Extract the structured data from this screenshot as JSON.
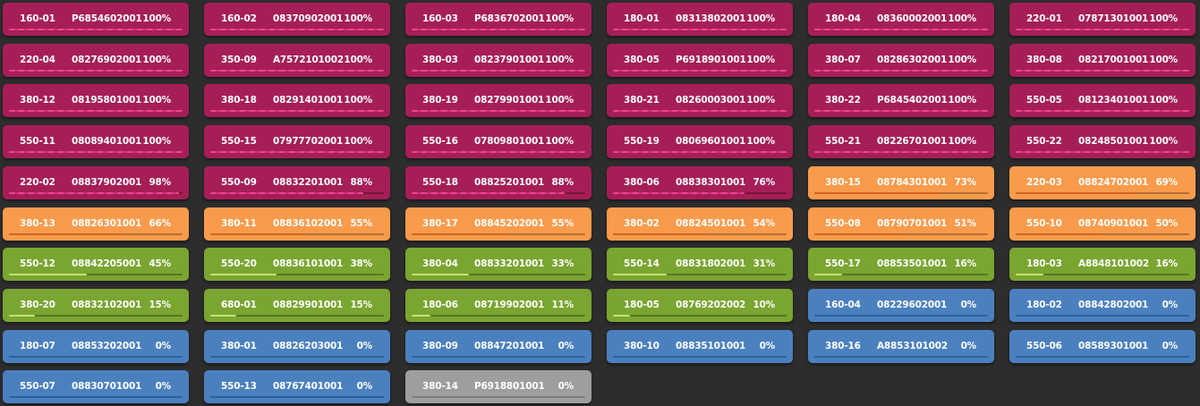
{
  "colors": {
    "complete": "#a61e57",
    "in_progress": "#f99b4b",
    "started": "#7aa531",
    "not_started": "#4b80bf",
    "inactive": "#9e9e9e"
  },
  "cards": [
    {
      "code": "160-01",
      "part": "P6854602001",
      "pct": "100%",
      "progress": 100,
      "status": "complete"
    },
    {
      "code": "160-02",
      "part": "08370902001",
      "pct": "100%",
      "progress": 100,
      "status": "complete"
    },
    {
      "code": "160-03",
      "part": "P6836702001",
      "pct": "100%",
      "progress": 100,
      "status": "complete"
    },
    {
      "code": "180-01",
      "part": "08313802001",
      "pct": "100%",
      "progress": 100,
      "status": "complete"
    },
    {
      "code": "180-04",
      "part": "08360002001",
      "pct": "100%",
      "progress": 100,
      "status": "complete"
    },
    {
      "code": "220-01",
      "part": "07871301001",
      "pct": "100%",
      "progress": 100,
      "status": "complete"
    },
    {
      "code": "220-04",
      "part": "08276902001",
      "pct": "100%",
      "progress": 100,
      "status": "complete"
    },
    {
      "code": "350-09",
      "part": "A7572101002",
      "pct": "100%",
      "progress": 100,
      "status": "complete"
    },
    {
      "code": "380-03",
      "part": "08237901001",
      "pct": "100%",
      "progress": 100,
      "status": "complete"
    },
    {
      "code": "380-05",
      "part": "P6918901001",
      "pct": "100%",
      "progress": 100,
      "status": "complete"
    },
    {
      "code": "380-07",
      "part": "08286302001",
      "pct": "100%",
      "progress": 100,
      "status": "complete"
    },
    {
      "code": "380-08",
      "part": "08217001001",
      "pct": "100%",
      "progress": 100,
      "status": "complete"
    },
    {
      "code": "380-12",
      "part": "08195801001",
      "pct": "100%",
      "progress": 100,
      "status": "complete"
    },
    {
      "code": "380-18",
      "part": "08291401001",
      "pct": "100%",
      "progress": 100,
      "status": "complete"
    },
    {
      "code": "380-19",
      "part": "08279901001",
      "pct": "100%",
      "progress": 100,
      "status": "complete"
    },
    {
      "code": "380-21",
      "part": "08260003001",
      "pct": "100%",
      "progress": 100,
      "status": "complete"
    },
    {
      "code": "380-22",
      "part": "P6845402001",
      "pct": "100%",
      "progress": 100,
      "status": "complete"
    },
    {
      "code": "550-05",
      "part": "08123401001",
      "pct": "100%",
      "progress": 100,
      "status": "complete"
    },
    {
      "code": "550-11",
      "part": "08089401001",
      "pct": "100%",
      "progress": 100,
      "status": "complete"
    },
    {
      "code": "550-15",
      "part": "07977702001",
      "pct": "100%",
      "progress": 100,
      "status": "complete"
    },
    {
      "code": "550-16",
      "part": "07809801001",
      "pct": "100%",
      "progress": 100,
      "status": "complete"
    },
    {
      "code": "550-19",
      "part": "08069601001",
      "pct": "100%",
      "progress": 100,
      "status": "complete"
    },
    {
      "code": "550-21",
      "part": "08226701001",
      "pct": "100%",
      "progress": 100,
      "status": "complete"
    },
    {
      "code": "550-22",
      "part": "08248501001",
      "pct": "100%",
      "progress": 100,
      "status": "complete"
    },
    {
      "code": "220-02",
      "part": "08837902001",
      "pct": "98%",
      "progress": 98,
      "status": "complete"
    },
    {
      "code": "550-09",
      "part": "08832201001",
      "pct": "88%",
      "progress": 88,
      "status": "complete"
    },
    {
      "code": "550-18",
      "part": "08825201001",
      "pct": "88%",
      "progress": 88,
      "status": "complete"
    },
    {
      "code": "380-06",
      "part": "08838301001",
      "pct": "76%",
      "progress": 76,
      "status": "complete"
    },
    {
      "code": "380-15",
      "part": "08784301001",
      "pct": "73%",
      "progress": 73,
      "status": "in_progress"
    },
    {
      "code": "220-03",
      "part": "08824702001",
      "pct": "69%",
      "progress": 69,
      "status": "in_progress"
    },
    {
      "code": "380-13",
      "part": "08826301001",
      "pct": "66%",
      "progress": 66,
      "status": "in_progress"
    },
    {
      "code": "380-11",
      "part": "08836102001",
      "pct": "55%",
      "progress": 55,
      "status": "in_progress"
    },
    {
      "code": "380-17",
      "part": "08845202001",
      "pct": "55%",
      "progress": 55,
      "status": "in_progress"
    },
    {
      "code": "380-02",
      "part": "08824501001",
      "pct": "54%",
      "progress": 54,
      "status": "in_progress"
    },
    {
      "code": "550-08",
      "part": "08790701001",
      "pct": "51%",
      "progress": 51,
      "status": "in_progress"
    },
    {
      "code": "550-10",
      "part": "08740901001",
      "pct": "50%",
      "progress": 50,
      "status": "in_progress"
    },
    {
      "code": "550-12",
      "part": "08842205001",
      "pct": "45%",
      "progress": 45,
      "status": "started"
    },
    {
      "code": "550-20",
      "part": "08836101001",
      "pct": "38%",
      "progress": 38,
      "status": "started"
    },
    {
      "code": "380-04",
      "part": "08833201001",
      "pct": "33%",
      "progress": 33,
      "status": "started"
    },
    {
      "code": "550-14",
      "part": "08831802001",
      "pct": "31%",
      "progress": 31,
      "status": "started"
    },
    {
      "code": "550-17",
      "part": "08853501001",
      "pct": "16%",
      "progress": 16,
      "status": "started"
    },
    {
      "code": "180-03",
      "part": "A8848101002",
      "pct": "16%",
      "progress": 16,
      "status": "started"
    },
    {
      "code": "380-20",
      "part": "08832102001",
      "pct": "15%",
      "progress": 15,
      "status": "started"
    },
    {
      "code": "680-01",
      "part": "08829901001",
      "pct": "15%",
      "progress": 15,
      "status": "started"
    },
    {
      "code": "180-06",
      "part": "08719902001",
      "pct": "11%",
      "progress": 11,
      "status": "started"
    },
    {
      "code": "180-05",
      "part": "08769202002",
      "pct": "10%",
      "progress": 10,
      "status": "started"
    },
    {
      "code": "160-04",
      "part": "08229602001",
      "pct": "0%",
      "progress": 0,
      "status": "not_started"
    },
    {
      "code": "180-02",
      "part": "08842802001",
      "pct": "0%",
      "progress": 0,
      "status": "not_started"
    },
    {
      "code": "180-07",
      "part": "08853202001",
      "pct": "0%",
      "progress": 0,
      "status": "not_started"
    },
    {
      "code": "380-01",
      "part": "08826203001",
      "pct": "0%",
      "progress": 0,
      "status": "not_started"
    },
    {
      "code": "380-09",
      "part": "08847201001",
      "pct": "0%",
      "progress": 0,
      "status": "not_started"
    },
    {
      "code": "380-10",
      "part": "08835101001",
      "pct": "0%",
      "progress": 0,
      "status": "not_started"
    },
    {
      "code": "380-16",
      "part": "A8853101002",
      "pct": "0%",
      "progress": 0,
      "status": "not_started"
    },
    {
      "code": "550-06",
      "part": "08589301001",
      "pct": "0%",
      "progress": 0,
      "status": "not_started"
    },
    {
      "code": "550-07",
      "part": "08830701001",
      "pct": "0%",
      "progress": 0,
      "status": "not_started"
    },
    {
      "code": "550-13",
      "part": "08767401001",
      "pct": "0%",
      "progress": 0,
      "status": "not_started"
    },
    {
      "code": "380-14",
      "part": "P6918801001",
      "pct": "0%",
      "progress": 0,
      "status": "inactive"
    }
  ]
}
